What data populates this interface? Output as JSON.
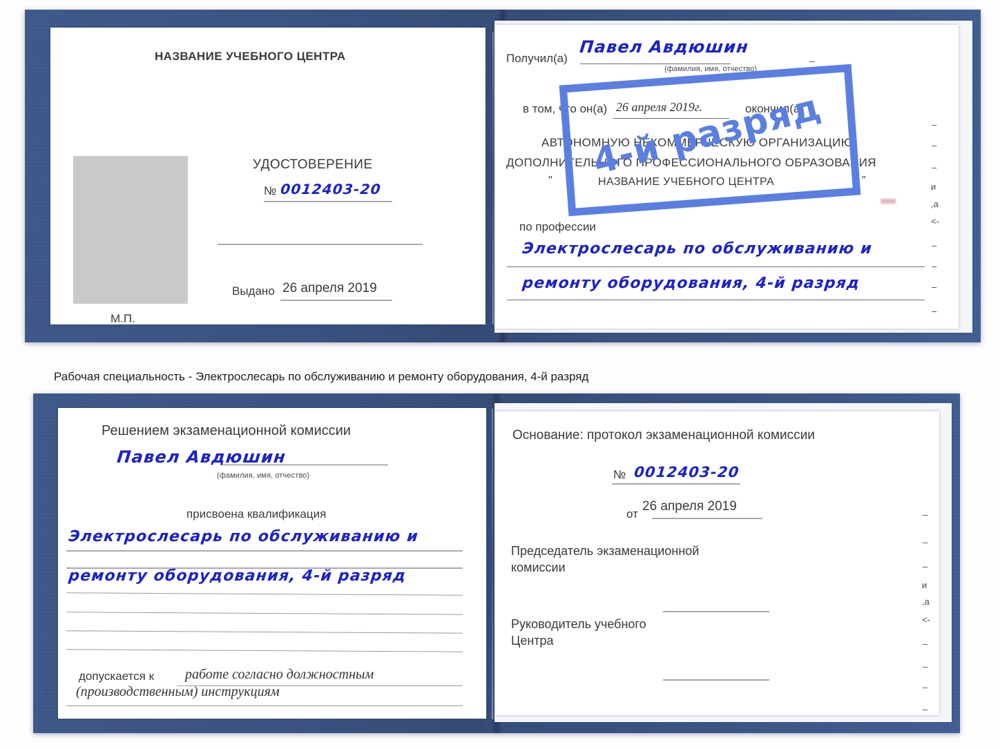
{
  "document": {
    "kind": "certificate-scan",
    "language": "ru",
    "caption": "Рабочая специальность - Электрослесарь по обслуживанию и ремонту оборудования, 4-й разряд"
  },
  "colors": {
    "cover_blue": "#27457e",
    "stamp_blue": "#5b7fe0",
    "handwriting_blue": "#1a22cc",
    "page_white": "#ffffff",
    "photo_placeholder_grey": "#c9c9c9",
    "rule_grey": "#9a9a9a"
  },
  "certificate_top": {
    "left_page": {
      "org_title": "НАЗВАНИЕ УЧЕБНОГО ЦЕНТРА",
      "doc_title": "УДОСТОВЕРЕНИЕ",
      "number_symbol": "№",
      "number_value": "0012403-20",
      "issued_label": "Выдано",
      "issued_value": "26 апреля 2019",
      "stamp_place_label": "М.П.",
      "photo_placeholder": "photo-placeholder"
    },
    "right_page": {
      "received_label": "Получил(а)",
      "received_value": "Павел Авдюшин",
      "fio_hint": "(фамилия, имя, отчество)",
      "in_that_label": "в том, что он(а)",
      "completion_date": "26 апреля 2019г.",
      "finished_label": "окончил(а)",
      "org_line_1": "АВТОНОМНУЮ НЕКОММЕРЧЕСКУЮ ОРГАНИЗАЦИЮ",
      "org_line_2": "ДОПОЛНИТЕЛЬНОГО ПРОФЕССИОНАЛЬНОГО ОБРАЗОВАНИЯ",
      "org_quote_open": "\"",
      "org_line_3": "НАЗВАНИЕ УЧЕБНОГО ЦЕНТРА",
      "org_quote_close": "\"",
      "profession_label": "по профессии",
      "profession_value_line_1": "Электрослесарь по обслуживанию и",
      "profession_value_line_2": "ремонту оборудования, 4-й разряд",
      "stamp_text": "4-й разряд",
      "edge_fragments": [
        "—",
        "—",
        "—",
        "и",
        "а",
        "к-",
        "—",
        "—",
        "—",
        "—"
      ]
    }
  },
  "certificate_bottom": {
    "left_page": {
      "heading": "Решением экзаменационной комиссии",
      "name_value": "Павел Авдюшин",
      "fio_hint": "(фамилия, имя, отчество)",
      "qualification_label": "присвоена квалификация",
      "qualification_line_1": "Электрослесарь по обслуживанию и",
      "qualification_line_2": "ремонту оборудования, 4-й разряд",
      "admitted_label": "допускается к",
      "admitted_value_line_1": "работе согласно должностным",
      "admitted_value_line_2": "(производственным) инструкциям"
    },
    "right_page": {
      "basis_label": "Основание: протокол экзаменационной комиссии",
      "number_symbol": "№",
      "number_value": "0012403-20",
      "date_label": "от",
      "date_value": "26 апреля 2019",
      "chairman_line_1": "Председатель экзаменационной",
      "chairman_line_2": "комиссии",
      "head_line_1": "Руководитель учебного",
      "head_line_2": "Центра",
      "edge_fragments": [
        "—",
        "—",
        "—",
        "и",
        "а",
        "к-",
        "—",
        "—",
        "—",
        "—"
      ]
    }
  }
}
